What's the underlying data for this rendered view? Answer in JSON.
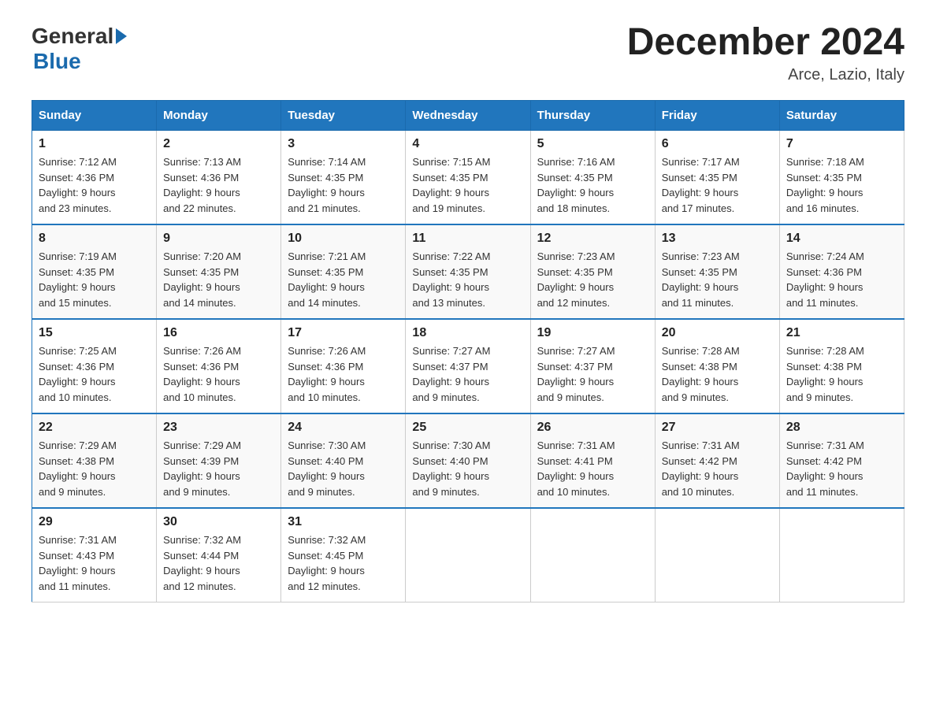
{
  "header": {
    "logo": {
      "general": "General",
      "blue": "Blue"
    },
    "title": "December 2024",
    "location": "Arce, Lazio, Italy"
  },
  "days_of_week": [
    "Sunday",
    "Monday",
    "Tuesday",
    "Wednesday",
    "Thursday",
    "Friday",
    "Saturday"
  ],
  "weeks": [
    [
      {
        "day": "1",
        "sunrise": "7:12 AM",
        "sunset": "4:36 PM",
        "daylight": "9 hours and 23 minutes."
      },
      {
        "day": "2",
        "sunrise": "7:13 AM",
        "sunset": "4:36 PM",
        "daylight": "9 hours and 22 minutes."
      },
      {
        "day": "3",
        "sunrise": "7:14 AM",
        "sunset": "4:35 PM",
        "daylight": "9 hours and 21 minutes."
      },
      {
        "day": "4",
        "sunrise": "7:15 AM",
        "sunset": "4:35 PM",
        "daylight": "9 hours and 19 minutes."
      },
      {
        "day": "5",
        "sunrise": "7:16 AM",
        "sunset": "4:35 PM",
        "daylight": "9 hours and 18 minutes."
      },
      {
        "day": "6",
        "sunrise": "7:17 AM",
        "sunset": "4:35 PM",
        "daylight": "9 hours and 17 minutes."
      },
      {
        "day": "7",
        "sunrise": "7:18 AM",
        "sunset": "4:35 PM",
        "daylight": "9 hours and 16 minutes."
      }
    ],
    [
      {
        "day": "8",
        "sunrise": "7:19 AM",
        "sunset": "4:35 PM",
        "daylight": "9 hours and 15 minutes."
      },
      {
        "day": "9",
        "sunrise": "7:20 AM",
        "sunset": "4:35 PM",
        "daylight": "9 hours and 14 minutes."
      },
      {
        "day": "10",
        "sunrise": "7:21 AM",
        "sunset": "4:35 PM",
        "daylight": "9 hours and 14 minutes."
      },
      {
        "day": "11",
        "sunrise": "7:22 AM",
        "sunset": "4:35 PM",
        "daylight": "9 hours and 13 minutes."
      },
      {
        "day": "12",
        "sunrise": "7:23 AM",
        "sunset": "4:35 PM",
        "daylight": "9 hours and 12 minutes."
      },
      {
        "day": "13",
        "sunrise": "7:23 AM",
        "sunset": "4:35 PM",
        "daylight": "9 hours and 11 minutes."
      },
      {
        "day": "14",
        "sunrise": "7:24 AM",
        "sunset": "4:36 PM",
        "daylight": "9 hours and 11 minutes."
      }
    ],
    [
      {
        "day": "15",
        "sunrise": "7:25 AM",
        "sunset": "4:36 PM",
        "daylight": "9 hours and 10 minutes."
      },
      {
        "day": "16",
        "sunrise": "7:26 AM",
        "sunset": "4:36 PM",
        "daylight": "9 hours and 10 minutes."
      },
      {
        "day": "17",
        "sunrise": "7:26 AM",
        "sunset": "4:36 PM",
        "daylight": "9 hours and 10 minutes."
      },
      {
        "day": "18",
        "sunrise": "7:27 AM",
        "sunset": "4:37 PM",
        "daylight": "9 hours and 9 minutes."
      },
      {
        "day": "19",
        "sunrise": "7:27 AM",
        "sunset": "4:37 PM",
        "daylight": "9 hours and 9 minutes."
      },
      {
        "day": "20",
        "sunrise": "7:28 AM",
        "sunset": "4:38 PM",
        "daylight": "9 hours and 9 minutes."
      },
      {
        "day": "21",
        "sunrise": "7:28 AM",
        "sunset": "4:38 PM",
        "daylight": "9 hours and 9 minutes."
      }
    ],
    [
      {
        "day": "22",
        "sunrise": "7:29 AM",
        "sunset": "4:38 PM",
        "daylight": "9 hours and 9 minutes."
      },
      {
        "day": "23",
        "sunrise": "7:29 AM",
        "sunset": "4:39 PM",
        "daylight": "9 hours and 9 minutes."
      },
      {
        "day": "24",
        "sunrise": "7:30 AM",
        "sunset": "4:40 PM",
        "daylight": "9 hours and 9 minutes."
      },
      {
        "day": "25",
        "sunrise": "7:30 AM",
        "sunset": "4:40 PM",
        "daylight": "9 hours and 9 minutes."
      },
      {
        "day": "26",
        "sunrise": "7:31 AM",
        "sunset": "4:41 PM",
        "daylight": "9 hours and 10 minutes."
      },
      {
        "day": "27",
        "sunrise": "7:31 AM",
        "sunset": "4:42 PM",
        "daylight": "9 hours and 10 minutes."
      },
      {
        "day": "28",
        "sunrise": "7:31 AM",
        "sunset": "4:42 PM",
        "daylight": "9 hours and 11 minutes."
      }
    ],
    [
      {
        "day": "29",
        "sunrise": "7:31 AM",
        "sunset": "4:43 PM",
        "daylight": "9 hours and 11 minutes."
      },
      {
        "day": "30",
        "sunrise": "7:32 AM",
        "sunset": "4:44 PM",
        "daylight": "9 hours and 12 minutes."
      },
      {
        "day": "31",
        "sunrise": "7:32 AM",
        "sunset": "4:45 PM",
        "daylight": "9 hours and 12 minutes."
      },
      null,
      null,
      null,
      null
    ]
  ],
  "labels": {
    "sunrise": "Sunrise:",
    "sunset": "Sunset:",
    "daylight": "Daylight:"
  }
}
